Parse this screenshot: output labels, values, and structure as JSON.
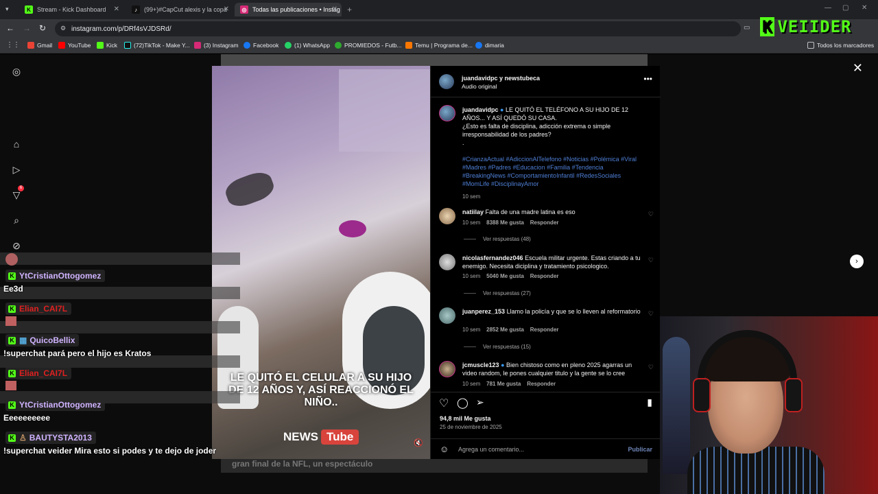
{
  "browser": {
    "tabs": [
      {
        "title": "Stream - Kick Dashboard",
        "active": false
      },
      {
        "title": "(99+)#CapCut alexis y la copa",
        "active": false
      },
      {
        "title": "Todas las publicaciones • Instag",
        "active": true
      }
    ],
    "url": "instagram.com/p/DRf4sVJDSRd/",
    "bookmarks": [
      "Gmail",
      "YouTube",
      "Kick",
      "(72)TikTok - Make Y...",
      "(3) Instagram",
      "Facebook",
      "(1) WhatsApp",
      "PROMIEDOS - Futb...",
      "Temu | Programa de...",
      "dimaria"
    ],
    "all_bookmarks": "Todos los marcadores"
  },
  "sidebar": {
    "notification_count": "6"
  },
  "post": {
    "header_user": "juandavidpc y newstubeca",
    "header_audio": "Audio original",
    "author": "juandavidpc",
    "caption_line1": "LE QUITÓ EL TELÉFONO A SU HIJO DE 12 AÑOS... Y ASÍ QUEDÓ SU CASA.",
    "caption_line2": "¿Esto es falta de disciplina, adicción extrema o simple irresponsabilidad de los padres?",
    "caption_dot": ".",
    "hashtags": "#CrianzaActual #AdiccionAlTelefono #Noticias #Polémica #Viral #Madres #Padres #Educacion #Familia #Tendencia #BreakingNews #ComportamientoInfantil #RedesSociales #MomLife #DisciplinayAmor",
    "caption_time": "10 sem",
    "video_caption": "LE QUITÓ EL CELULAR A SU HIJO DE 12 AÑOS Y, ASÍ REACCIONÓ EL NIÑO..",
    "brand_news": "NEWS",
    "brand_tube": "Tube",
    "likes": "94,8 mil Me gusta",
    "date": "25 de noviembre de 2025",
    "add_comment_placeholder": "Agrega un comentario...",
    "publish": "Publicar"
  },
  "comments": [
    {
      "user": "natiilay",
      "text": "Falta de una madre latina es eso",
      "time": "10 sem",
      "likes": "8388 Me gusta",
      "reply": "Responder",
      "replies": "Ver respuestas (48)"
    },
    {
      "user": "nicolasfernandez046",
      "text": "Escuela militar urgente. Estas criando a tu enemigo. Necesita diciplina y tratamiento psicologico.",
      "time": "10 sem",
      "likes": "5040 Me gusta",
      "reply": "Responder",
      "replies": "Ver respuestas (27)"
    },
    {
      "user": "juanperez_153",
      "text": "Llamo la policía y que se lo lleven al reformatorio",
      "time": "10 sem",
      "likes": "2852 Me gusta",
      "reply": "Responder",
      "replies": "Ver respuestas (15)"
    },
    {
      "user": "jcmuscle123",
      "text": "Bien chistoso como en pleno 2025 agarras un video random, le pones cualquier titulo y la gente se lo cree",
      "time": "10 sem",
      "likes": "781 Me gusta",
      "reply": "Responder",
      "replies": ""
    }
  ],
  "chat": [
    {
      "name": "YtCristianOttogomez",
      "color": "#d0b3ff",
      "message": "Ee3d"
    },
    {
      "name": "Elian_CAI7L",
      "color": "#e02020",
      "message": ""
    },
    {
      "name": "QuicoBellix",
      "color": "#d0b3ff",
      "message": "!superchat pará pero el hijo es Kratos"
    },
    {
      "name": "Elian_CAI7L",
      "color": "#e02020",
      "message": ""
    },
    {
      "name": "YtCristianOttogomez",
      "color": "#d0b3ff",
      "message": "Eeeeeeeeee"
    },
    {
      "name": "BAUTYSTA2013",
      "color": "#d0b3ff",
      "message": "!superchat veider Mira esto si podes y te dejo de joder"
    }
  ],
  "logo": {
    "k": "K",
    "text": "VEIIDER"
  },
  "background_post": {
    "text": "gran final de la NFL, un espectáculo"
  },
  "colors": {
    "kick_green": "#53fc18",
    "ig_blue": "#4f7fd6",
    "chat_red": "#e02020"
  }
}
